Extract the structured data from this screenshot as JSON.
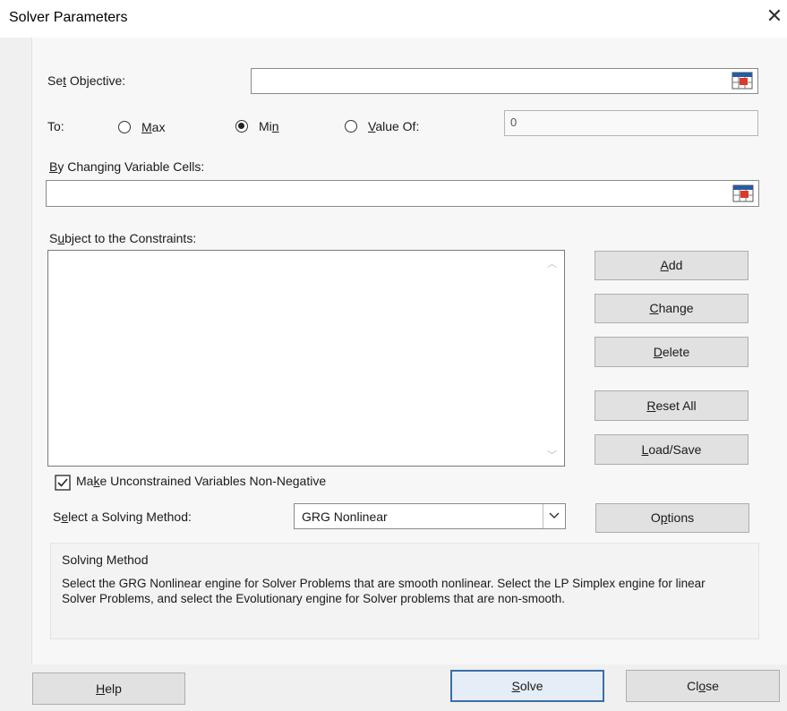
{
  "window": {
    "title": "Solver Parameters",
    "close_glyph": "✕"
  },
  "objective": {
    "label": "Set Objective:",
    "value": ""
  },
  "to": {
    "label": "To:",
    "options": [
      {
        "label": "Max",
        "selected": false
      },
      {
        "label": "Min",
        "selected": true
      },
      {
        "label": "Value Of:",
        "selected": false
      }
    ],
    "value_of": "0"
  },
  "changing": {
    "label": "By Changing Variable Cells:",
    "value": ""
  },
  "constraints": {
    "label": "Subject to the Constraints:",
    "items": []
  },
  "side_buttons": {
    "add": "Add",
    "change": "Change",
    "delete": "Delete",
    "reset_all": "Reset All",
    "load_save": "Load/Save"
  },
  "nonneg": {
    "label": "Make Unconstrained Variables Non-Negative",
    "checked": true
  },
  "method": {
    "label": "Select a Solving Method:",
    "selected": "GRG Nonlinear",
    "options_button": "Options"
  },
  "info": {
    "heading": "Solving Method",
    "text": "Select the GRG Nonlinear engine for Solver Problems that are smooth nonlinear. Select the LP Simplex engine for linear Solver Problems, and select the Evolutionary engine for Solver problems that are non-smooth."
  },
  "footer": {
    "help": "Help",
    "solve": "Solve",
    "close": "Close"
  }
}
